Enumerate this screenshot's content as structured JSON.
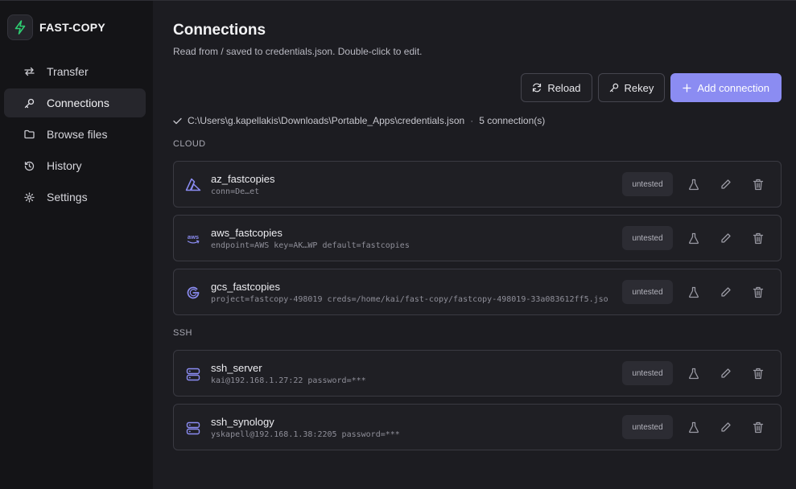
{
  "app": {
    "name": "FAST-COPY"
  },
  "nav": [
    {
      "label": "Transfer",
      "icon": "arrows-swap-icon",
      "active": false
    },
    {
      "label": "Connections",
      "icon": "key-icon",
      "active": true
    },
    {
      "label": "Browse files",
      "icon": "folder-icon",
      "active": false
    },
    {
      "label": "History",
      "icon": "history-icon",
      "active": false
    },
    {
      "label": "Settings",
      "icon": "gear-icon",
      "active": false
    }
  ],
  "page": {
    "title": "Connections",
    "subtitle": "Read from / saved to credentials.json. Double-click to edit."
  },
  "toolbar": {
    "reload": "Reload",
    "rekey": "Rekey",
    "add": "Add connection"
  },
  "status": {
    "path": "C:\\Users\\g.kapellakis\\Downloads\\Portable_Apps\\credentials.json",
    "separator": "·",
    "count": "5 connection(s)"
  },
  "sections": {
    "cloud": "CLOUD",
    "ssh": "SSH"
  },
  "connections": {
    "az": {
      "name": "az_fastcopies",
      "detail": "conn=De…et",
      "status": "untested",
      "icon": "azure-icon"
    },
    "aws": {
      "name": "aws_fastcopies",
      "detail": "endpoint=AWS  key=AK…WP  default=fastcopies",
      "status": "untested",
      "icon": "aws-icon"
    },
    "gcs": {
      "name": "gcs_fastcopies",
      "detail": "project=fastcopy-498019  creds=/home/kai/fast-copy/fastcopy-498019-33a083612ff5.jso",
      "status": "untested",
      "icon": "google-icon"
    },
    "ssh_server": {
      "name": "ssh_server",
      "detail": "kai@192.168.1.27:22  password=***",
      "status": "untested",
      "icon": "server-icon"
    },
    "ssh_synology": {
      "name": "ssh_synology",
      "detail": "yskapell@192.168.1.38:2205  password=***",
      "status": "untested",
      "icon": "server-icon"
    }
  },
  "colors": {
    "accent": "#8b8cf2",
    "brand_green": "#2ecc71",
    "background": "#1c1c21",
    "sidebar": "#141417"
  }
}
